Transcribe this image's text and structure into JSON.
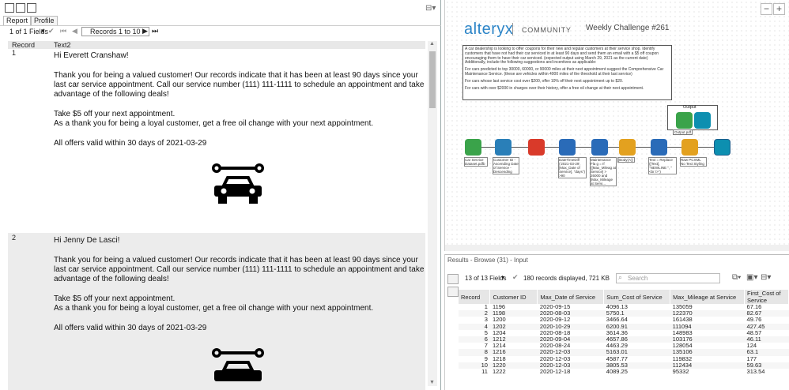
{
  "report_panel": {
    "tabs": [
      "Report",
      "Profile"
    ],
    "fields_label": "1 of 1 Fields",
    "records_label": "Records 1 to 10",
    "col_record": "Record",
    "col_text": "Text2",
    "rows": [
      {
        "num": "1",
        "greeting": "Hi Everett Cranshaw!",
        "p1": "Thank you for being a valued customer! Our records indicate that it has been at least 90 days since your last car service appointment. Call our service number (111) 111-1111 to schedule an appointment and take advantage of the following deals!",
        "p2a": "Take $5 off your next appointment.",
        "p2b": "As a thank you for being a loyal customer, get a free oil change with your next appointment.",
        "p3": "All offers valid within 30 days of 2021-03-29"
      },
      {
        "num": "2",
        "greeting": "Hi Jenny De Lasci!",
        "p1": "Thank you for being a valued customer! Our records indicate that it has been at least 90 days since your last car service appointment. Call our service number (111) 111-1111 to schedule an appointment and take advantage of the following deals!",
        "p2a": "Take $5 off your next appointment.",
        "p2b": "As a thank you for being a loyal customer, get a free oil change with your next appointment.",
        "p3": "All offers valid within 30 days of 2021-03-29"
      }
    ]
  },
  "canvas": {
    "logo": "alteryx",
    "community": "COMMUNITY",
    "weekly": "Weekly Challenge #261",
    "comment": [
      "A car dealership is looking to offer coupons for their new and regular customers at their service shop. Identify customers that have not had their car serviced in at least 90 days and send them an email with a $5 off coupon encouraging them to have their car serviced. (expected output using March 29, 2021 as the current date) Additionally, include the following suggestions and incentives as applicable:",
      "For cars predicted to top 30000, 60000, or 90000 miles at their next appointment suggest the Comprehensive Car Maintenance Service. (these are vehicles within 4000 miles of the threshold at their last service)",
      "For cars whose last service cost over $200, offer 10% off their next appointment up to $20.",
      "For cars with over $2000 in charges over their history, offer a free oil change at their next appointment."
    ],
    "output_label": "Output",
    "output_file": "Output.pdf",
    "annotations": {
      "input": "Car Service Dataset.pdfb",
      "sort": "Customer ID - Ascending Date of Service - Descending",
      "filter": "DateTimeDiff ('2021-03-29', [Max_Date of Service], \"days\") >90",
      "formula1": "Maintenance Fla g = If ([Max_Mileag at Service] > 26000 and [Max_Mileage at Servi...",
      "body": "[Body(A)]",
      "formula2": "Text = Replace ([Text], \"NEWLINE \", \"<br />\")",
      "render": "Raw PCXML No Text Styling"
    }
  },
  "results": {
    "title": "Results - Browse (31) - Input",
    "fields_label": "13 of 13 Fields",
    "records_label": "180 records displayed, 721 KB",
    "search_placeholder": "Search",
    "columns": [
      "Record",
      "Customer ID",
      "Max_Date of Service",
      "Sum_Cost of Service",
      "Max_Mileage at Service",
      "First_Cost of Service"
    ],
    "rows": [
      [
        "1",
        "1196",
        "2020-09-15",
        "4096.13",
        "135059",
        "67.16"
      ],
      [
        "2",
        "1198",
        "2020-08-03",
        "5750.1",
        "122370",
        "82.67"
      ],
      [
        "3",
        "1200",
        "2020-09-12",
        "3466.64",
        "161438",
        "49.76"
      ],
      [
        "4",
        "1202",
        "2020-10-29",
        "6200.91",
        "111094",
        "427.45"
      ],
      [
        "5",
        "1204",
        "2020-08-18",
        "3614.36",
        "148983",
        "48.57"
      ],
      [
        "6",
        "1212",
        "2020-09-04",
        "4657.86",
        "103176",
        "46.11"
      ],
      [
        "7",
        "1214",
        "2020-08-24",
        "4463.29",
        "128054",
        "124"
      ],
      [
        "8",
        "1216",
        "2020-12-03",
        "5163.01",
        "135106",
        "63.1"
      ],
      [
        "9",
        "1218",
        "2020-12-03",
        "4587.77",
        "119832",
        "177"
      ],
      [
        "10",
        "1220",
        "2020-12-03",
        "3805.53",
        "112434",
        "59.63"
      ],
      [
        "11",
        "1222",
        "2020-12-18",
        "4089.25",
        "95332",
        "313.54"
      ]
    ]
  },
  "colors": {
    "input_tool": "#3aa34a",
    "sort_tool": "#2a7fb8",
    "summarize_tool": "#d93a2a",
    "formula_tool": "#2a6bb8",
    "doc_tool": "#e3a11f",
    "render_tool": "#0d8fb0"
  }
}
